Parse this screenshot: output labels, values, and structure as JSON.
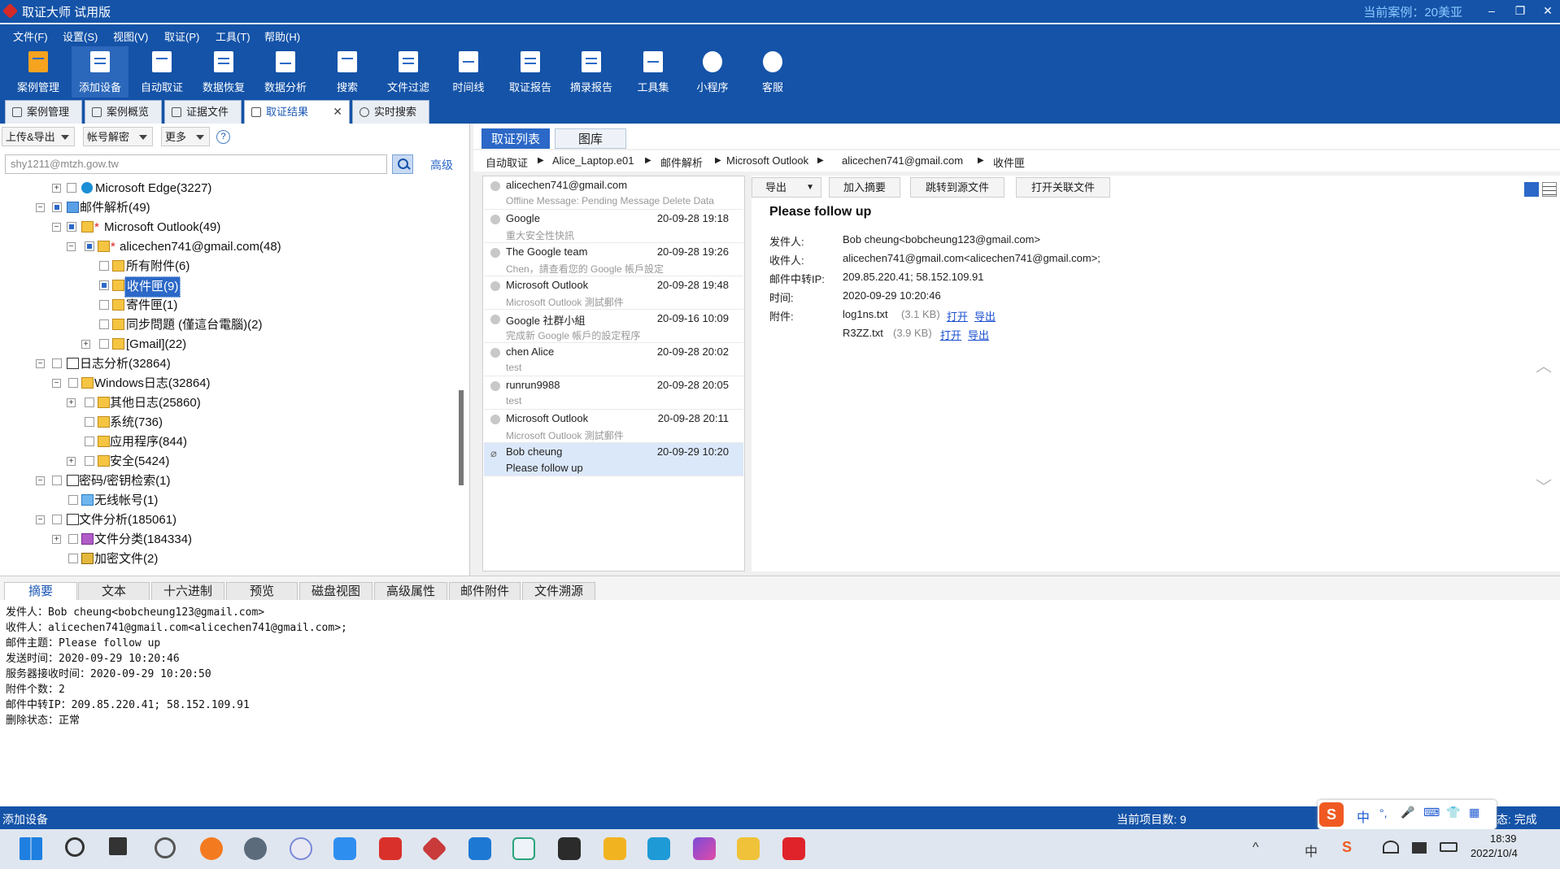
{
  "window": {
    "title": "取证大师 试用版",
    "current_case": "当前案例：20美亚",
    "buttons": {
      "minimize": "–",
      "restore": "❐",
      "close": "✕"
    }
  },
  "menu": [
    "文件(F)",
    "设置(S)",
    "视图(V)",
    "取证(P)",
    "工具(T)",
    "帮助(H)"
  ],
  "toolbar": [
    "案例管理",
    "添加设备",
    "自动取证",
    "数据恢复",
    "数据分析",
    "搜索",
    "文件过滤",
    "时间线",
    "取证报告",
    "摘录报告",
    "工具集",
    "小程序",
    "客服"
  ],
  "open_tabs": [
    "案例管理",
    "案例概览",
    "证据文件",
    "取证结果",
    "实时搜索"
  ],
  "left": {
    "dropdowns": [
      "上传&导出",
      "帐号解密",
      "更多"
    ],
    "help": "?",
    "search_value": "shy1211@mtzh.gow.tw",
    "advanced": "高级",
    "tree": [
      {
        "label": "Microsoft Edge(3227)"
      },
      {
        "label": "邮件解析(49)"
      },
      {
        "label": "Microsoft Outlook(49)",
        "mark": "*"
      },
      {
        "label": "alicechen741@gmail.com(48)",
        "mark": "*"
      },
      {
        "label": "所有附件(6)"
      },
      {
        "label": "收件匣(9)"
      },
      {
        "label": "寄件匣(1)"
      },
      {
        "label": "同步問題 (僅這台電腦)(2)"
      },
      {
        "label": "[Gmail](22)"
      },
      {
        "label": "日志分析(32864)"
      },
      {
        "label": "Windows日志(32864)"
      },
      {
        "label": "其他日志(25860)"
      },
      {
        "label": "系统(736)"
      },
      {
        "label": "应用程序(844)"
      },
      {
        "label": "安全(5424)"
      },
      {
        "label": "密码/密钥检索(1)"
      },
      {
        "label": "无线帐号(1)"
      },
      {
        "label": "文件分析(185061)"
      },
      {
        "label": "文件分类(184334)"
      },
      {
        "label": "加密文件(2)"
      }
    ]
  },
  "right_tabs": [
    "取证列表",
    "图库"
  ],
  "breadcrumb": [
    "自动取证",
    "Alice_Laptop.e01",
    "邮件解析",
    "Microsoft Outlook",
    "alicechen741@gmail.com",
    "收件匣"
  ],
  "mail_list": [
    {
      "from": "alicechen741@gmail.com",
      "date": "",
      "subject": "Offline Message: Pending Message Delete Data"
    },
    {
      "from": "Google",
      "date": "20-09-28 19:18",
      "subject": "重大安全性快訊"
    },
    {
      "from": "The Google team",
      "date": "20-09-28 19:26",
      "subject": "Chen，請查看您的 Google 帳戶設定"
    },
    {
      "from": "Microsoft Outlook",
      "date": "20-09-28 19:48",
      "subject": "Microsoft Outlook 測試郵件"
    },
    {
      "from": "Google 社群小組",
      "date": "20-09-16 10:09",
      "subject": "完成新 Google 帳戶的設定程序"
    },
    {
      "from": "chen Alice",
      "date": "20-09-28 20:02",
      "subject": "test"
    },
    {
      "from": "runrun9988",
      "date": "20-09-28 20:05",
      "subject": "test"
    },
    {
      "from": "Microsoft Outlook",
      "date": "20-09-28 20:11",
      "subject": "Microsoft Outlook 測試郵件"
    },
    {
      "from": "Bob cheung",
      "date": "20-09-29 10:20",
      "subject": "Please follow up"
    }
  ],
  "mail_actions": [
    "导出",
    "加入摘要",
    "跳转到源文件",
    "打开关联文件"
  ],
  "mail_view": {
    "subject": "Please follow up",
    "fields": [
      {
        "label": "发件人:",
        "value": "Bob cheung<bobcheung123@gmail.com>"
      },
      {
        "label": "收件人:",
        "value": "alicechen741@gmail.com<alicechen741@gmail.com>;"
      },
      {
        "label": "邮件中转IP:",
        "value": "209.85.220.41; 58.152.109.91"
      },
      {
        "label": "时间:",
        "value": "2020-09-29 10:20:46"
      },
      {
        "label": "附件:",
        "value": ""
      }
    ],
    "attachments": [
      {
        "name": "log1ns.txt",
        "size": "(3.1 KB)",
        "open": "打开",
        "export": "导出"
      },
      {
        "name": "R3ZZ.txt",
        "size": "(3.9 KB)",
        "open": "打开",
        "export": "导出"
      }
    ]
  },
  "bottom_tabs": [
    "摘要",
    "文本",
    "十六进制",
    "预览",
    "磁盘视图",
    "高级属性",
    "邮件附件",
    "文件溯源"
  ],
  "summary_lines": [
    "发件人：Bob cheung<bobcheung123@gmail.com>",
    "收件人：alicechen741@gmail.com<alicechen741@gmail.com>;",
    "邮件主题：Please follow up",
    "发送时间：2020-09-29 10:20:46",
    "服务器接收时间：2020-09-29 10:20:50",
    "附件个数：2",
    "邮件中转IP：209.85.220.41; 58.152.109.91",
    "删除状态：正常"
  ],
  "status": {
    "left": "添加设备",
    "count": "当前项目数: 9",
    "right": "态: 完成"
  },
  "ime": [
    "中",
    "°,",
    "🎤",
    "⌨",
    "👕",
    "▦"
  ],
  "clock": {
    "time": "18:39",
    "date": "2022/10/4"
  },
  "tray": [
    "^",
    "中",
    "S"
  ],
  "colors": {
    "titlebar": "#1453a8",
    "accent": "#2b68c7",
    "selected_row": "#dbe8fa"
  }
}
